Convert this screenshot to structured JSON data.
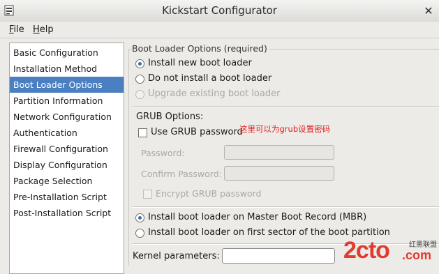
{
  "window": {
    "title": "Kickstart Configurator"
  },
  "menu": [
    {
      "mnemonic": "F",
      "rest": "ile"
    },
    {
      "mnemonic": "H",
      "rest": "elp"
    }
  ],
  "sidebar": {
    "items": [
      {
        "label": "Basic Configuration"
      },
      {
        "label": "Installation Method"
      },
      {
        "label": "Boot Loader Options",
        "selected": true
      },
      {
        "label": "Partition Information"
      },
      {
        "label": "Network Configuration"
      },
      {
        "label": "Authentication"
      },
      {
        "label": "Firewall Configuration"
      },
      {
        "label": "Display Configuration"
      },
      {
        "label": "Package Selection"
      },
      {
        "label": "Pre-Installation Script"
      },
      {
        "label": "Post-Installation Script"
      }
    ]
  },
  "boot": {
    "group_title": "Boot Loader Options (required)",
    "install_new": "Install new boot loader",
    "do_not_install": "Do not install a boot loader",
    "upgrade_existing": "Upgrade existing boot loader",
    "selected_option": "Install new boot loader"
  },
  "grub": {
    "title": "GRUB Options:",
    "use_password": "Use GRUB password",
    "use_password_checked": false,
    "password_label": "Password:",
    "password_value": "",
    "confirm_label": "Confirm Password:",
    "confirm_value": "",
    "encrypt_label": "Encrypt GRUB password",
    "encrypt_checked": false
  },
  "mbr": {
    "install_mbr": "Install boot loader on Master Boot Record (MBR)",
    "install_first_sector": "Install boot loader on first sector of the boot partition",
    "selected_option": "Install boot loader on Master Boot Record (MBR)"
  },
  "kernel": {
    "label": "Kernel parameters:",
    "value": ""
  },
  "annotation": {
    "text": "这里可以为grub设置密码",
    "color": "#e0201e"
  },
  "watermark": {
    "text": "2cto",
    "suffix": ".com",
    "tagline": "红黑联盟"
  },
  "colors": {
    "selection": "#4a7fc1",
    "radio_dot": "#3b6ea8",
    "watermark": "#e23a2e"
  }
}
